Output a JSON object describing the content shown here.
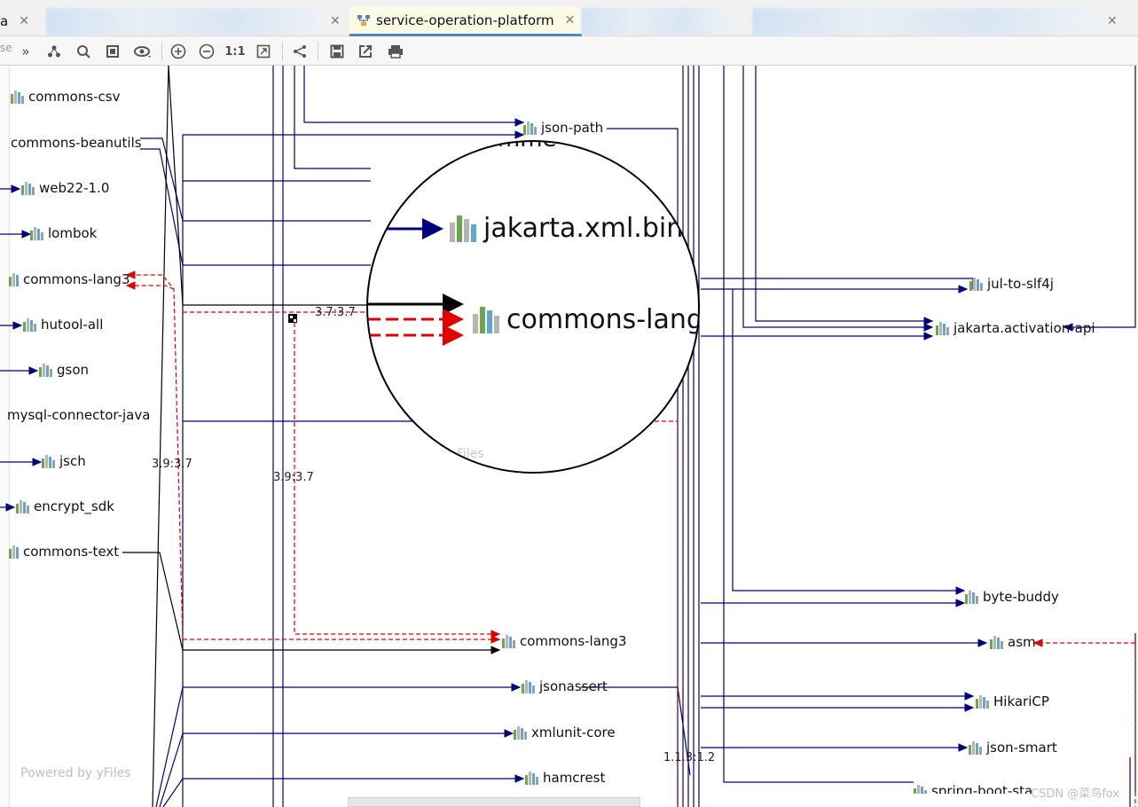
{
  "tabs": {
    "left_partial": "a",
    "active": "service-operation-platform"
  },
  "toolbar_icons": [
    "collapse-icon",
    "hierarchy-icon",
    "find-icon",
    "select-icon",
    "eye-icon",
    "zoom-in-icon",
    "zoom-out-icon",
    "actual-size-icon",
    "fit-icon",
    "layout-icon",
    "save-icon",
    "export-icon",
    "print-icon"
  ],
  "toolbar": {
    "actual_size_label": "1:1",
    "left_stub": "se"
  },
  "colors": {
    "edge_blue": "#00007f",
    "edge_red": "#e00000",
    "edge_black": "#000000"
  },
  "nodes_left": [
    {
      "label": "commons-csv"
    },
    {
      "label": "commons-beanutils"
    },
    {
      "label": "web22-1.0"
    },
    {
      "label": "lombok"
    },
    {
      "label": "commons-lang3"
    },
    {
      "label": "hutool-all"
    },
    {
      "label": "gson"
    },
    {
      "label": "mysql-connector-java"
    },
    {
      "label": "jsch"
    },
    {
      "label": "encrypt_sdk"
    },
    {
      "label": "commons-text"
    }
  ],
  "nodes_middle": [
    {
      "label": "json-path"
    },
    {
      "label": "commons-lang3"
    },
    {
      "label": "jsonassert"
    },
    {
      "label": "xmlunit-core"
    },
    {
      "label": "hamcrest"
    }
  ],
  "nodes_right": [
    {
      "label": "jul-to-slf4j"
    },
    {
      "label": "jakarta.activation-api"
    },
    {
      "label": "byte-buddy"
    },
    {
      "label": "asm"
    },
    {
      "label": "HikariCP"
    },
    {
      "label": "json-smart"
    },
    {
      "label": "spring-boot-sta"
    }
  ],
  "edge_labels": {
    "top_version": "3.7:3.7",
    "version_a": "3.9:3.7",
    "version_b": "3.9:3.7",
    "version_c": "1.1.3:1.2"
  },
  "lens": {
    "top_partial": "omme",
    "node_1": "jakarta.xml.bind",
    "node_2": "commons-lang",
    "bottom_partial": "Files"
  },
  "footer": {
    "powered": "Powered by yFiles",
    "watermark": "CSDN @菜鸟fox"
  }
}
